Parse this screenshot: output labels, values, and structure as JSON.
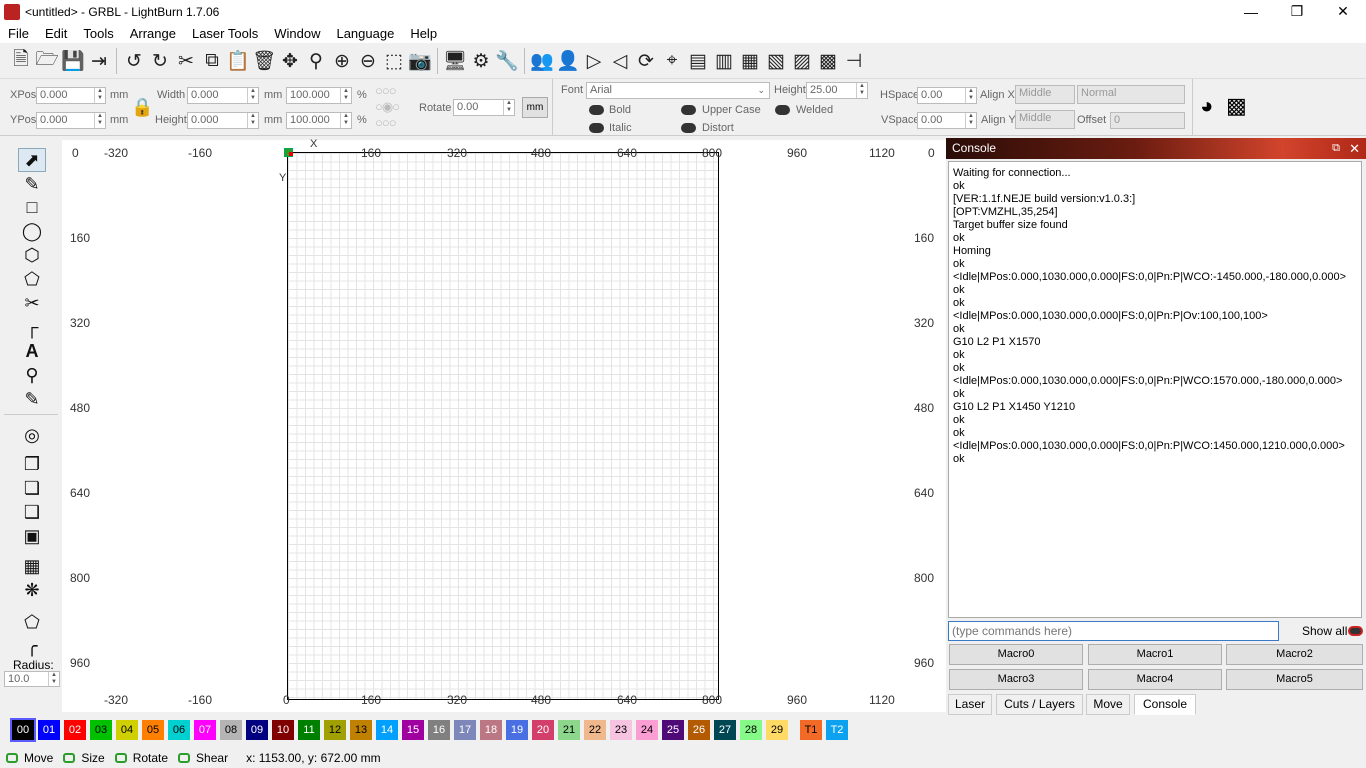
{
  "window": {
    "title": "<untitled> - GRBL - LightBurn 1.7.06"
  },
  "menu": [
    "File",
    "Edit",
    "Tools",
    "Arrange",
    "Laser Tools",
    "Window",
    "Language",
    "Help"
  ],
  "toolbar_icons": [
    "new-file-icon",
    "open-file-icon",
    "save-icon",
    "import-icon",
    "undo-icon",
    "redo-icon",
    "cut-icon",
    "copy-icon",
    "paste-icon",
    "delete-icon",
    "move-icon",
    "zoom-fit-icon",
    "zoom-in-icon",
    "zoom-out-icon",
    "zoom-page-icon",
    "camera-icon",
    "frame-icon",
    "settings-icon",
    "tools-icon",
    "group-icon",
    "ungroup-icon",
    "mirror-h-icon",
    "mirror-v-icon",
    "rotate-icon",
    "target-icon",
    "align-left-icon",
    "align-right-icon",
    "align-top-icon",
    "align-bottom-icon",
    "distribute-h-icon",
    "distribute-v-icon",
    "move-together-icon"
  ],
  "props": {
    "xpos_label": "XPos",
    "xpos_value": "0.000",
    "ypos_label": "YPos",
    "ypos_value": "0.000",
    "unit_mm": "mm",
    "width_label": "Width",
    "width_value": "0.000",
    "height_label": "Height",
    "height_value": "0.000",
    "scale_w": "100.000",
    "scale_h": "100.000",
    "percent": "%",
    "rotate_label": "Rotate",
    "rotate_value": "0.00",
    "mm_button": "mm",
    "font_label": "Font",
    "font_value": "Arial",
    "font_height_label": "Height",
    "font_height_value": "25.00",
    "hspace_label": "HSpace",
    "hspace_value": "0.00",
    "vspace_label": "VSpace",
    "vspace_value": "0.00",
    "alignx_label": "Align X",
    "alignx_value": "Middle",
    "aligny_label": "Align Y",
    "aligny_value": "Middle",
    "mode_value": "Normal",
    "offset_label": "Offset",
    "offset_value": "0",
    "bold": "Bold",
    "italic": "Italic",
    "upper": "Upper Case",
    "distort": "Distort",
    "welded": "Welded"
  },
  "ruler": {
    "top": [
      "0",
      "-320",
      "-160",
      "160",
      "320",
      "480",
      "640",
      "800",
      "960",
      "1120",
      "0"
    ],
    "left": [
      "160",
      "320",
      "480",
      "640",
      "800",
      "960"
    ],
    "right": [
      "160",
      "320",
      "480",
      "640",
      "800",
      "960"
    ],
    "bottom": [
      "-320",
      "-160",
      "0",
      "160",
      "320",
      "480",
      "640",
      "800",
      "960",
      "1120"
    ],
    "x_axis": "X",
    "y_axis": "Y"
  },
  "radius": {
    "label": "Radius:",
    "value": "10.0"
  },
  "console": {
    "title": "Console",
    "log": "Waiting for connection...\nok\n[VER:1.1f.NEJE build version:v1.0.3:]\n[OPT:VMZHL,35,254]\nTarget buffer size found\nok\nHoming\nok\n<Idle|MPos:0.000,1030.000,0.000|FS:0,0|Pn:P|WCO:-1450.000,-180.000,0.000>\nok\nok\n<Idle|MPos:0.000,1030.000,0.000|FS:0,0|Pn:P|Ov:100,100,100>\nok\nG10 L2 P1 X1570\nok\nok\n<Idle|MPos:0.000,1030.000,0.000|FS:0,0|Pn:P|WCO:1570.000,-180.000,0.000>\nok\nG10 L2 P1 X1450 Y1210\nok\nok\n<Idle|MPos:0.000,1030.000,0.000|FS:0,0|Pn:P|WCO:1450.000,1210.000,0.000>\nok",
    "placeholder": "(type commands here)",
    "show_all": "Show all",
    "macros": [
      "Macro0",
      "Macro1",
      "Macro2",
      "Macro3",
      "Macro4",
      "Macro5"
    ]
  },
  "tabs": [
    "Laser",
    "Cuts / Layers",
    "Move",
    "Console"
  ],
  "palette": [
    {
      "label": "00",
      "color": "#000000",
      "fg": "#ffffff"
    },
    {
      "label": "01",
      "color": "#0000ff",
      "fg": "#ffffff"
    },
    {
      "label": "02",
      "color": "#ff0000",
      "fg": "#ffffff"
    },
    {
      "label": "03",
      "color": "#00c000",
      "fg": "#000000"
    },
    {
      "label": "04",
      "color": "#d0d000",
      "fg": "#000000"
    },
    {
      "label": "05",
      "color": "#ff8000",
      "fg": "#000000"
    },
    {
      "label": "06",
      "color": "#00d0d0",
      "fg": "#000000"
    },
    {
      "label": "07",
      "color": "#ff00ff",
      "fg": "#ffffff"
    },
    {
      "label": "08",
      "color": "#b4b4b4",
      "fg": "#000000"
    },
    {
      "label": "09",
      "color": "#000080",
      "fg": "#ffffff"
    },
    {
      "label": "10",
      "color": "#800000",
      "fg": "#ffffff"
    },
    {
      "label": "11",
      "color": "#008000",
      "fg": "#ffffff"
    },
    {
      "label": "12",
      "color": "#a0a000",
      "fg": "#000000"
    },
    {
      "label": "13",
      "color": "#c08000",
      "fg": "#000000"
    },
    {
      "label": "14",
      "color": "#00a0ff",
      "fg": "#ffffff"
    },
    {
      "label": "15",
      "color": "#a000a0",
      "fg": "#ffffff"
    },
    {
      "label": "16",
      "color": "#808080",
      "fg": "#ffffff"
    },
    {
      "label": "17",
      "color": "#7d87b9",
      "fg": "#ffffff"
    },
    {
      "label": "18",
      "color": "#bb7784",
      "fg": "#ffffff"
    },
    {
      "label": "19",
      "color": "#4a6fe3",
      "fg": "#ffffff"
    },
    {
      "label": "20",
      "color": "#d33f6a",
      "fg": "#ffffff"
    },
    {
      "label": "21",
      "color": "#8cd78c",
      "fg": "#000000"
    },
    {
      "label": "22",
      "color": "#f0b98d",
      "fg": "#000000"
    },
    {
      "label": "23",
      "color": "#f6c4e1",
      "fg": "#000000"
    },
    {
      "label": "24",
      "color": "#fa9ed4",
      "fg": "#000000"
    },
    {
      "label": "25",
      "color": "#500a78",
      "fg": "#ffffff"
    },
    {
      "label": "26",
      "color": "#b45a00",
      "fg": "#ffffff"
    },
    {
      "label": "27",
      "color": "#004754",
      "fg": "#ffffff"
    },
    {
      "label": "28",
      "color": "#86fa88",
      "fg": "#000000"
    },
    {
      "label": "29",
      "color": "#ffdb66",
      "fg": "#000000"
    },
    {
      "label": "T1",
      "color": "#f36926",
      "fg": "#000000"
    },
    {
      "label": "T2",
      "color": "#0ca2f0",
      "fg": "#ffffff"
    }
  ],
  "status": {
    "move": "Move",
    "size": "Size",
    "rotate": "Rotate",
    "shear": "Shear",
    "coords": "x: 1153.00, y: 672.00 mm"
  }
}
